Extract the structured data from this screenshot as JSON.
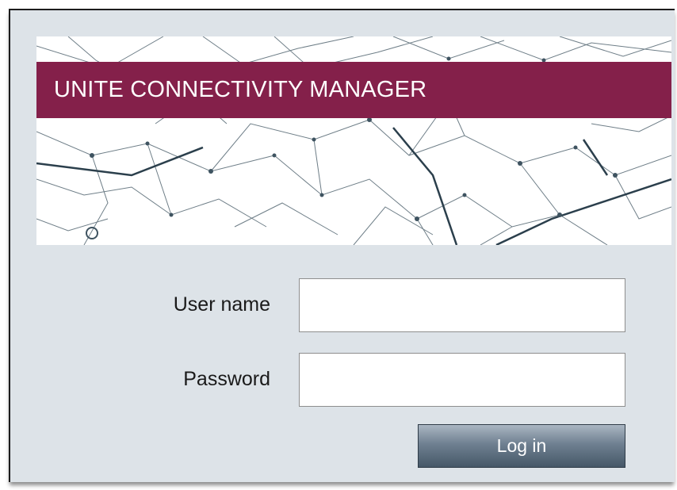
{
  "app": {
    "title": "UNITE CONNECTIVITY MANAGER",
    "accent_color": "#84204a",
    "panel_color": "#dde3e8"
  },
  "login_form": {
    "username_label": "User name",
    "username_value": "",
    "password_label": "Password",
    "password_value": "",
    "submit_label": "Log in"
  }
}
